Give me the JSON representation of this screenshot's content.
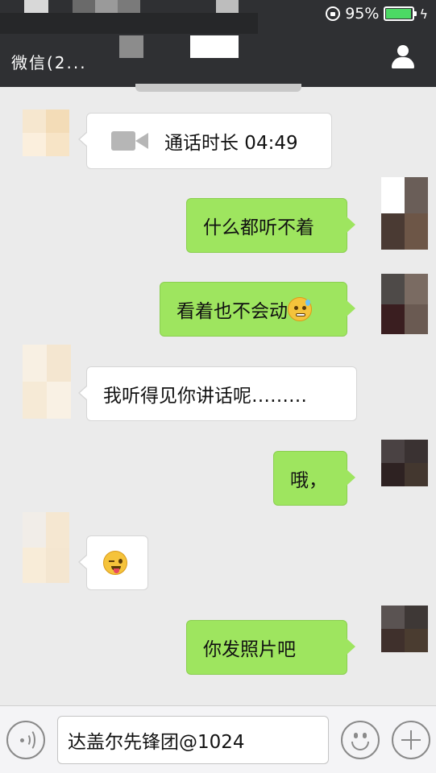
{
  "status_bar": {
    "battery_text": "95%",
    "battery_level": 0.95
  },
  "header": {
    "back_label": "微信(2..."
  },
  "messages": [
    {
      "side": "left",
      "type": "call",
      "text": "通话时长 04:49"
    },
    {
      "side": "right",
      "type": "text",
      "text": "什么都听不着"
    },
    {
      "side": "right",
      "type": "text_emoji",
      "text": "看着也不会动",
      "emoji": "sweat-emoji"
    },
    {
      "side": "left",
      "type": "text",
      "text": "我听得见你讲话呢………"
    },
    {
      "side": "right",
      "type": "text",
      "text": "哦，"
    },
    {
      "side": "left",
      "type": "emoji",
      "emoji": "wink-tongue-emoji"
    },
    {
      "side": "right",
      "type": "text",
      "text": "你发照片吧"
    }
  ],
  "input": {
    "value": "达盖尔先锋团@1024"
  },
  "colors": {
    "header_bg": "#2f3033",
    "chat_bg": "#ebebeb",
    "sent_bubble": "#9ee55f",
    "received_bubble": "#ffffff"
  }
}
